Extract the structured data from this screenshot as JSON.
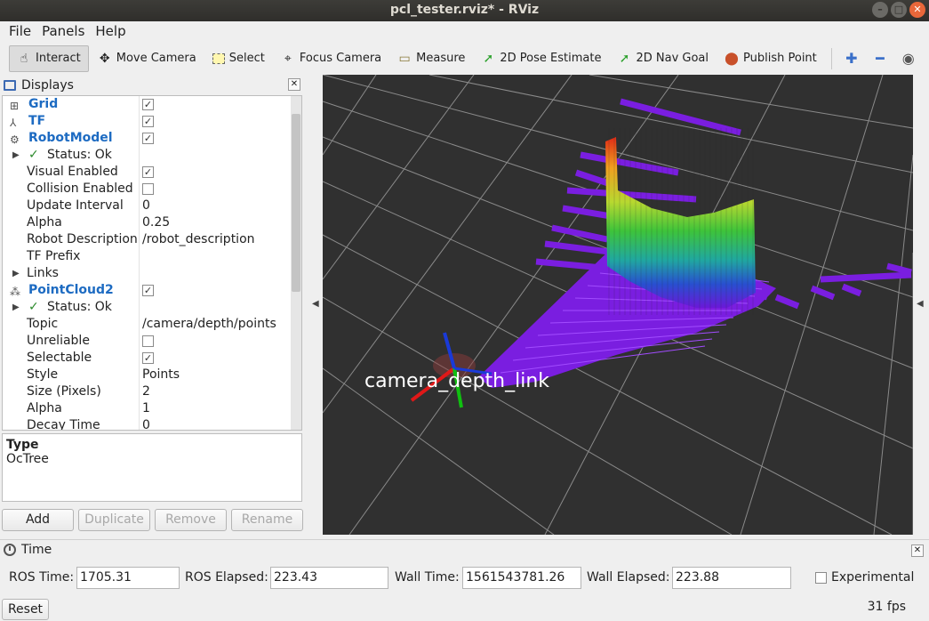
{
  "window": {
    "title": "pcl_tester.rviz* - RViz"
  },
  "menu": {
    "file": "File",
    "panels": "Panels",
    "help": "Help"
  },
  "toolbar": {
    "interact": "Interact",
    "move_camera": "Move Camera",
    "select": "Select",
    "focus_camera": "Focus Camera",
    "measure": "Measure",
    "pose_estimate": "2D Pose Estimate",
    "nav_goal": "2D Nav Goal",
    "publish_point": "Publish Point"
  },
  "displays": {
    "title": "Displays",
    "rows": [
      {
        "kind": "group",
        "icon": "grid-icon",
        "label": "Grid",
        "checked": true
      },
      {
        "kind": "group",
        "icon": "tf-icon",
        "label": "TF",
        "checked": true
      },
      {
        "kind": "group",
        "icon": "robot-icon",
        "label": "RobotModel",
        "checked": true
      },
      {
        "kind": "status",
        "label": "Status: Ok",
        "arrow": true
      },
      {
        "kind": "prop",
        "label": "Visual Enabled",
        "checked": true
      },
      {
        "kind": "prop",
        "label": "Collision Enabled",
        "checked": false
      },
      {
        "kind": "prop",
        "label": "Update Interval",
        "value": "0"
      },
      {
        "kind": "prop",
        "label": "Alpha",
        "value": "0.25"
      },
      {
        "kind": "prop",
        "label": "Robot Description",
        "value": "/robot_description"
      },
      {
        "kind": "prop",
        "label": "TF Prefix",
        "value": ""
      },
      {
        "kind": "prop",
        "label": "Links",
        "arrow": true
      },
      {
        "kind": "group",
        "icon": "pointcloud-icon",
        "label": "PointCloud2",
        "checked": true
      },
      {
        "kind": "status",
        "label": "Status: Ok",
        "arrow": true
      },
      {
        "kind": "prop",
        "label": "Topic",
        "value": "/camera/depth/points"
      },
      {
        "kind": "prop",
        "label": "Unreliable",
        "checked": false
      },
      {
        "kind": "prop",
        "label": "Selectable",
        "checked": true
      },
      {
        "kind": "prop",
        "label": "Style",
        "value": "Points"
      },
      {
        "kind": "prop",
        "label": "Size (Pixels)",
        "value": "2"
      },
      {
        "kind": "prop",
        "label": "Alpha",
        "value": "1"
      },
      {
        "kind": "prop",
        "label": "Decay Time",
        "value": "0"
      }
    ],
    "help_title": "Type",
    "help_text": "OcTree",
    "buttons": {
      "add": "Add",
      "duplicate": "Duplicate",
      "remove": "Remove",
      "rename": "Rename"
    }
  },
  "view": {
    "frame_label": "camera_depth_link"
  },
  "time": {
    "title": "Time",
    "ros_time_label": "ROS Time:",
    "ros_time": "1705.31",
    "ros_elapsed_label": "ROS Elapsed:",
    "ros_elapsed": "223.43",
    "wall_time_label": "Wall Time:",
    "wall_time": "1561543781.26",
    "wall_elapsed_label": "Wall Elapsed:",
    "wall_elapsed": "223.88",
    "experimental_label": "Experimental",
    "reset_label": "Reset",
    "fps": "31 fps"
  }
}
